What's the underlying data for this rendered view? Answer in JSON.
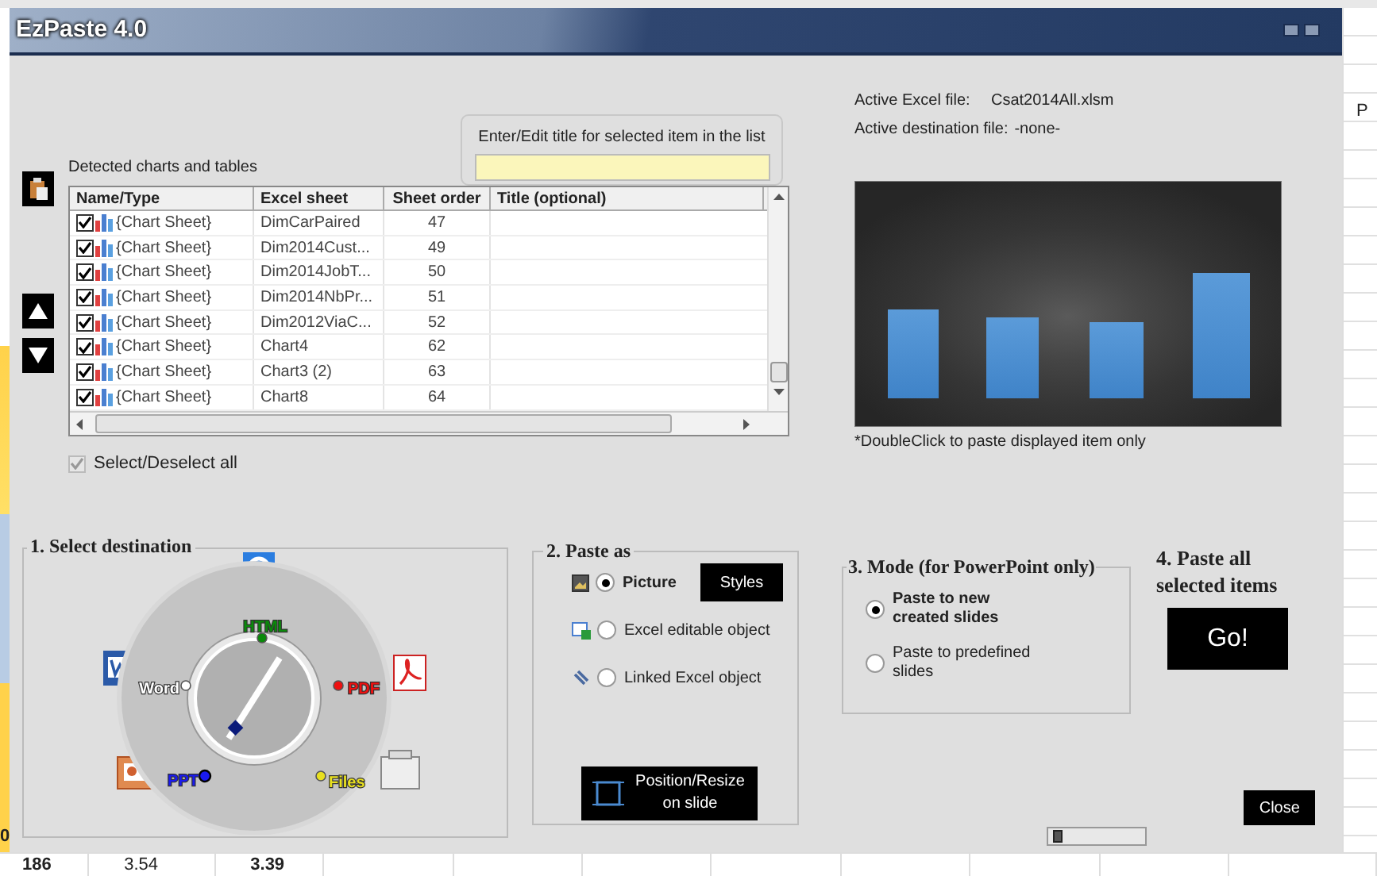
{
  "window": {
    "title": "EzPaste 4.0"
  },
  "spreadsheet": {
    "column_header": "P",
    "left_cell": "0",
    "bottom_row": [
      {
        "text": "186",
        "bold": true
      },
      {
        "text": "3.54",
        "bold": false
      },
      {
        "text": "3.39",
        "bold": true
      }
    ]
  },
  "title_editor": {
    "label": "Enter/Edit title for selected item in the list"
  },
  "list": {
    "label": "Detected charts and tables",
    "columns": [
      "Name/Type",
      "Excel sheet",
      "Sheet order",
      "Title (optional)"
    ],
    "rows": [
      {
        "checked": true,
        "name": "{Chart Sheet}",
        "sheet": "DimCarPaired",
        "order": "47"
      },
      {
        "checked": true,
        "name": "{Chart Sheet}",
        "sheet": "Dim2014Cust...",
        "order": "49"
      },
      {
        "checked": true,
        "name": "{Chart Sheet}",
        "sheet": "Dim2014JobT...",
        "order": "50"
      },
      {
        "checked": true,
        "name": "{Chart Sheet}",
        "sheet": "Dim2014NbPr...",
        "order": "51"
      },
      {
        "checked": true,
        "name": "{Chart Sheet}",
        "sheet": "Dim2012ViaC...",
        "order": "52"
      },
      {
        "checked": true,
        "name": "{Chart Sheet}",
        "sheet": "Chart4",
        "order": "62"
      },
      {
        "checked": true,
        "name": "{Chart Sheet}",
        "sheet": "Chart3 (2)",
        "order": "63"
      },
      {
        "checked": true,
        "name": "{Chart Sheet}",
        "sheet": "Chart8",
        "order": "64"
      }
    ]
  },
  "select_all": {
    "label": "Select/Deselect all",
    "checked": true,
    "disabled": true
  },
  "file_info": [
    {
      "label": "Active Excel file:",
      "value": "Csat2014All.xlsm"
    },
    {
      "label": "Active destination file:",
      "value": "-none-"
    }
  ],
  "preview": {
    "caption": "*DoubleClick to paste displayed item only"
  },
  "destination": {
    "title": "1. Select destination",
    "options": [
      {
        "label": "HTML",
        "color": "#0a8a0a",
        "selected": false
      },
      {
        "label": "Word",
        "color": "#ffffff",
        "selected": false
      },
      {
        "label": "PDF",
        "color": "#ee1111",
        "selected": false
      },
      {
        "label": "PPT",
        "color": "#1a1aee",
        "selected": true
      },
      {
        "label": "Files",
        "color": "#e8e020",
        "selected": false
      }
    ]
  },
  "paste_as": {
    "title": "2. Paste as",
    "options": [
      {
        "label": "Picture",
        "selected": true
      },
      {
        "label": "Excel editable object",
        "selected": false
      },
      {
        "label": "Linked Excel object",
        "selected": false
      }
    ],
    "styles_button": "Styles",
    "position_button": "Position/Resize on slide"
  },
  "mode": {
    "title": "3. Mode (for PowerPoint only)",
    "options": [
      {
        "label": "Paste to new created slides",
        "selected": true
      },
      {
        "label": "Paste to predefined slides",
        "selected": false
      }
    ]
  },
  "paste_all": {
    "title": "4. Paste all selected items",
    "button": "Go!"
  },
  "close_button": "Close",
  "slider": {
    "level": 0.05
  }
}
